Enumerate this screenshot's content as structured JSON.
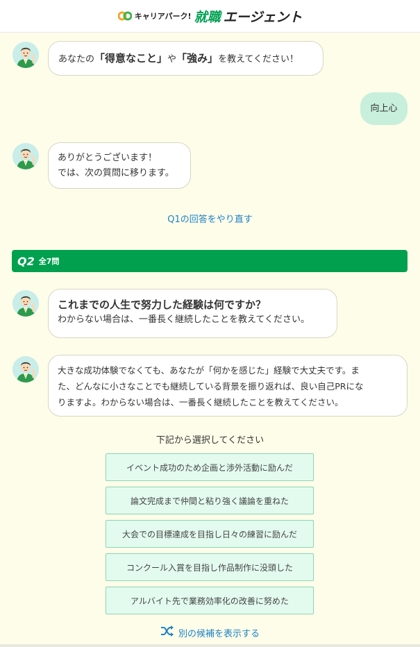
{
  "header": {
    "logo_small": "キャリアパーク!",
    "logo_shu": "就職",
    "logo_agent": "エージェント"
  },
  "chat": {
    "msg1": {
      "prefix": "あなたの",
      "bold1": "「得意なこと」",
      "mid": "や",
      "bold2": "「強み」",
      "suffix": "を教えてください！"
    },
    "user_reply": "向上心",
    "msg2": {
      "line1": "ありがとうございます！",
      "line2": "では、次の質問に移ります。"
    },
    "redo_link": "Q1の回答をやり直す",
    "q2": {
      "number": "Q2",
      "total": "全7問"
    },
    "msg3": {
      "title": "これまでの人生で努力した経験は何ですか？",
      "sub": "わからない場合は、一番長く継続したことを教えてください。"
    },
    "msg4": {
      "line1": "大きな成功体験でなくても、あなたが「何かを感じた」経験で大丈夫です。ま",
      "line2": "た、どんなに小さなことでも継続している背景を振り返れば、良い自己PRにな",
      "line3": "りますよ。わからない場合は、一番長く継続したことを教えてください。"
    },
    "select_prompt": "下記から選択してください",
    "options": [
      "イベント成功のため企画と渉外活動に励んだ",
      "論文完成まで仲間と粘り強く議論を重ねた",
      "大会での目標達成を目指し日々の練習に励んだ",
      "コンクール入賞を目指し作品制作に没頭した",
      "アルバイト先で業務効率化の改善に努めた"
    ],
    "more_link": "別の候補を表示する"
  },
  "colors": {
    "brand_green": "#00a04f",
    "link_blue": "#1d82c6",
    "page_bg": "#fdfde9",
    "option_bg": "#e3fbef",
    "user_bubble": "#c7efdc"
  },
  "icons": {
    "avatar": "agent-avatar-icon",
    "shuffle": "shuffle-icon",
    "logo_mark": "co-logo-icon"
  }
}
